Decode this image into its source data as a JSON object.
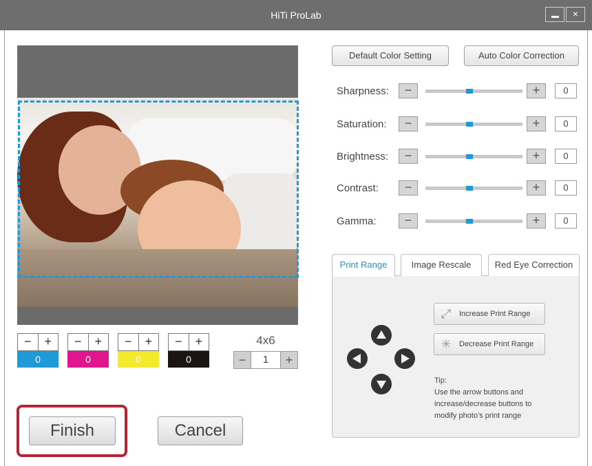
{
  "window": {
    "title": "HiTi ProLab",
    "minimize_icon": "minimize-icon",
    "close_glyph": "×"
  },
  "preview": {
    "frame_color": "#1f9ad6"
  },
  "color_adjust": [
    {
      "minus": "−",
      "plus": "+",
      "value": "0",
      "color": "#1f9ad6"
    },
    {
      "minus": "−",
      "plus": "+",
      "value": "0",
      "color": "#e0168c"
    },
    {
      "minus": "−",
      "plus": "+",
      "value": "0",
      "color": "#f2ea2a"
    },
    {
      "minus": "−",
      "plus": "+",
      "value": "0",
      "color": "#1a1513"
    }
  ],
  "print_size": {
    "label": "4x6",
    "copies": "1",
    "minus": "−",
    "plus": "+"
  },
  "buttons": {
    "finish": "Finish",
    "cancel": "Cancel",
    "default_color": "Default Color Setting",
    "auto_color": "Auto Color Correction",
    "highlight_color": "#b22436"
  },
  "adjustments": [
    {
      "label": "Sharpness:",
      "value": "0",
      "level": 0.45
    },
    {
      "label": "Saturation:",
      "value": "0",
      "level": 0.45
    },
    {
      "label": "Brightness:",
      "value": "0",
      "level": 0.45
    },
    {
      "label": "Contrast:",
      "value": "0",
      "level": 0.45
    },
    {
      "label": "Gamma:",
      "value": "0",
      "level": 0.45
    }
  ],
  "slider_buttons": {
    "minus": "−",
    "plus": "+"
  },
  "tabs": [
    {
      "label": "Print Range",
      "active": true
    },
    {
      "label": "Image Rescale",
      "active": false
    },
    {
      "label": "Red Eye Correction",
      "active": false
    }
  ],
  "print_range": {
    "increase": "Increase Print Range",
    "decrease": "Decrease Print Range",
    "increase_icon": "expand-arrows-icon",
    "decrease_icon": "collapse-arrows-icon",
    "tip_title": "Tip:",
    "tip_line1": "Use the arrow buttons and",
    "tip_line2": "increase/decrease buttons to",
    "tip_line3": "modify photo’s print range"
  },
  "accent_color": "#1c95c9"
}
